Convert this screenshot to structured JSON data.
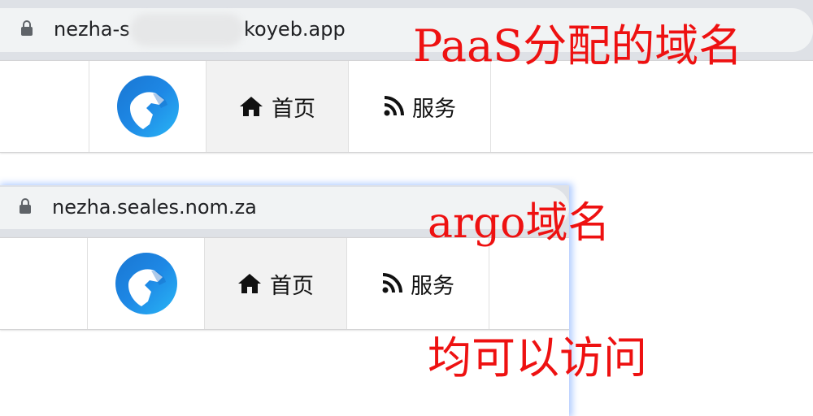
{
  "screenshot_top": {
    "url": {
      "prefix": "nezha-s",
      "suffix": "koyeb.app"
    },
    "nav": {
      "home_label": "首页",
      "service_label": "服务"
    }
  },
  "screenshot_bottom": {
    "url": "nezha.seales.nom.za",
    "nav": {
      "home_label": "首页",
      "service_label": "服务"
    }
  },
  "annotations": {
    "paas_domain": "PaaS分配的域名",
    "argo_domain": "argo域名",
    "both_accessible": "均可以访问"
  },
  "colors": {
    "annotation": "#ee1111",
    "logo": "#1e88e5",
    "focus_glow": "#508cff"
  },
  "icons": [
    "lock-icon",
    "nezha-logo-icon",
    "home-icon",
    "rss-icon"
  ]
}
